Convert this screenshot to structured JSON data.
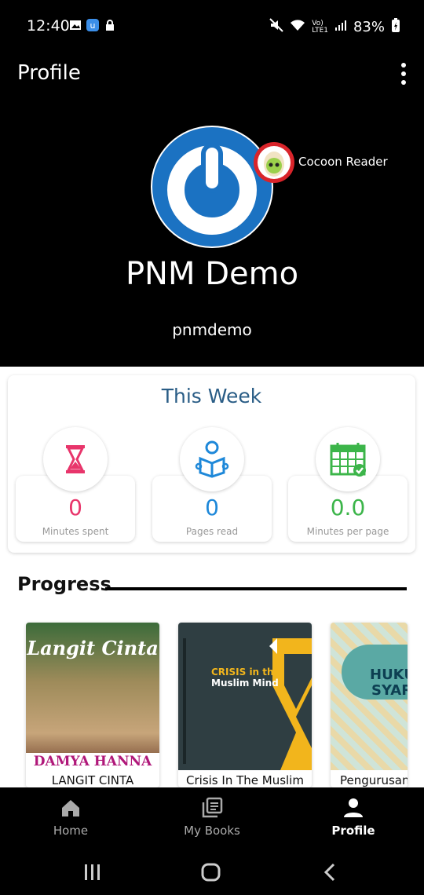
{
  "status": {
    "time": "12:40",
    "battery": "83%"
  },
  "header": {
    "title": "Profile",
    "name": "PNM Demo",
    "username": "pnmdemo",
    "badge_label": "Cocoon Reader"
  },
  "week": {
    "title": "This Week",
    "stats": [
      {
        "value": "0",
        "label": "Minutes spent",
        "color": "#e8356b",
        "icon": "hourglass-icon"
      },
      {
        "value": "0",
        "label": "Pages read",
        "color": "#1e88d9",
        "icon": "reader-icon"
      },
      {
        "value": "0.0",
        "label": "Minutes per page",
        "color": "#3cb54a",
        "icon": "calendar-icon"
      }
    ]
  },
  "progress": {
    "title": "Progress",
    "books": [
      {
        "title": "LANGIT CINTA",
        "cover_title": "Langit Cinta",
        "cover_author": "DAMYA HANNA"
      },
      {
        "title": "Crisis In The Muslim",
        "cover_title": "CRISIS in the",
        "cover_title2": "Muslim Mind"
      },
      {
        "title": "Pengurusan",
        "cover_title": "HUKUM",
        "cover_title2": "SYARA"
      }
    ]
  },
  "nav": {
    "tabs": [
      "Home",
      "My Books",
      "Profile"
    ],
    "active": "Profile"
  }
}
